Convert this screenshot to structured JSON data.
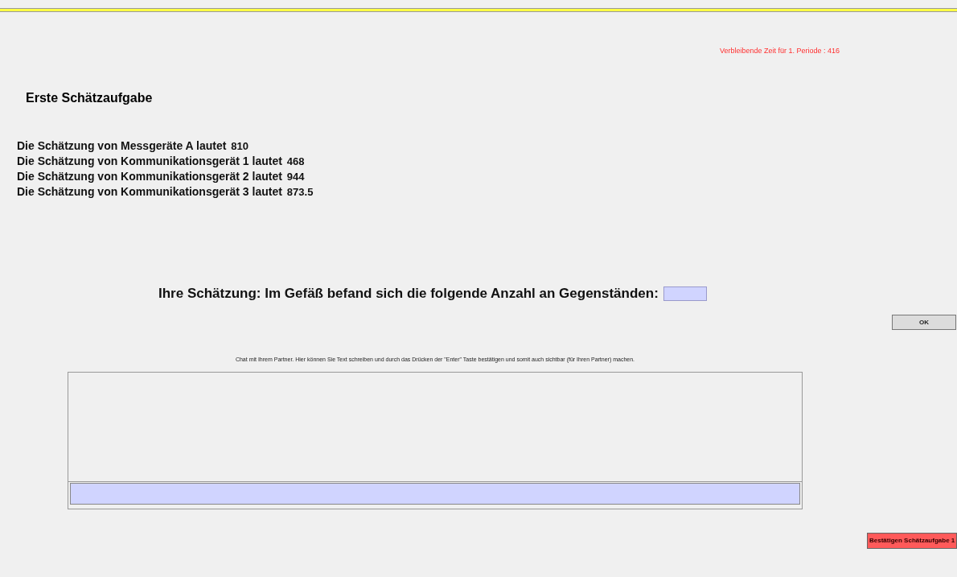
{
  "timer": "Verbleibende Zeit für 1. Periode : 416",
  "title": "Erste Schätzaufgabe",
  "estimates": [
    {
      "label": "Die Schätzung von Messgeräte A lautet",
      "value": "810"
    },
    {
      "label": "Die Schätzung von Kommunikationsgerät 1 lautet",
      "value": "468"
    },
    {
      "label": "Die Schätzung von Kommunikationsgerät 2 lautet",
      "value": "944"
    },
    {
      "label": "Die Schätzung von Kommunikationsgerät 3 lautet",
      "value": "873.5"
    }
  ],
  "question": "Ihre Schätzung: Im Gefäß befand sich die folgende Anzahl an Gegenständen:",
  "ok_button": "OK",
  "chat_instructions": "Chat mit Ihrem Partner. Hier können Sie Text schreiben und durch das Drücken der \"Enter\" Taste bestätigen und somit auch sichtbar (für Ihren Partner) machen.",
  "confirm_button": "Bestätigen Schätzaufgabe 1"
}
